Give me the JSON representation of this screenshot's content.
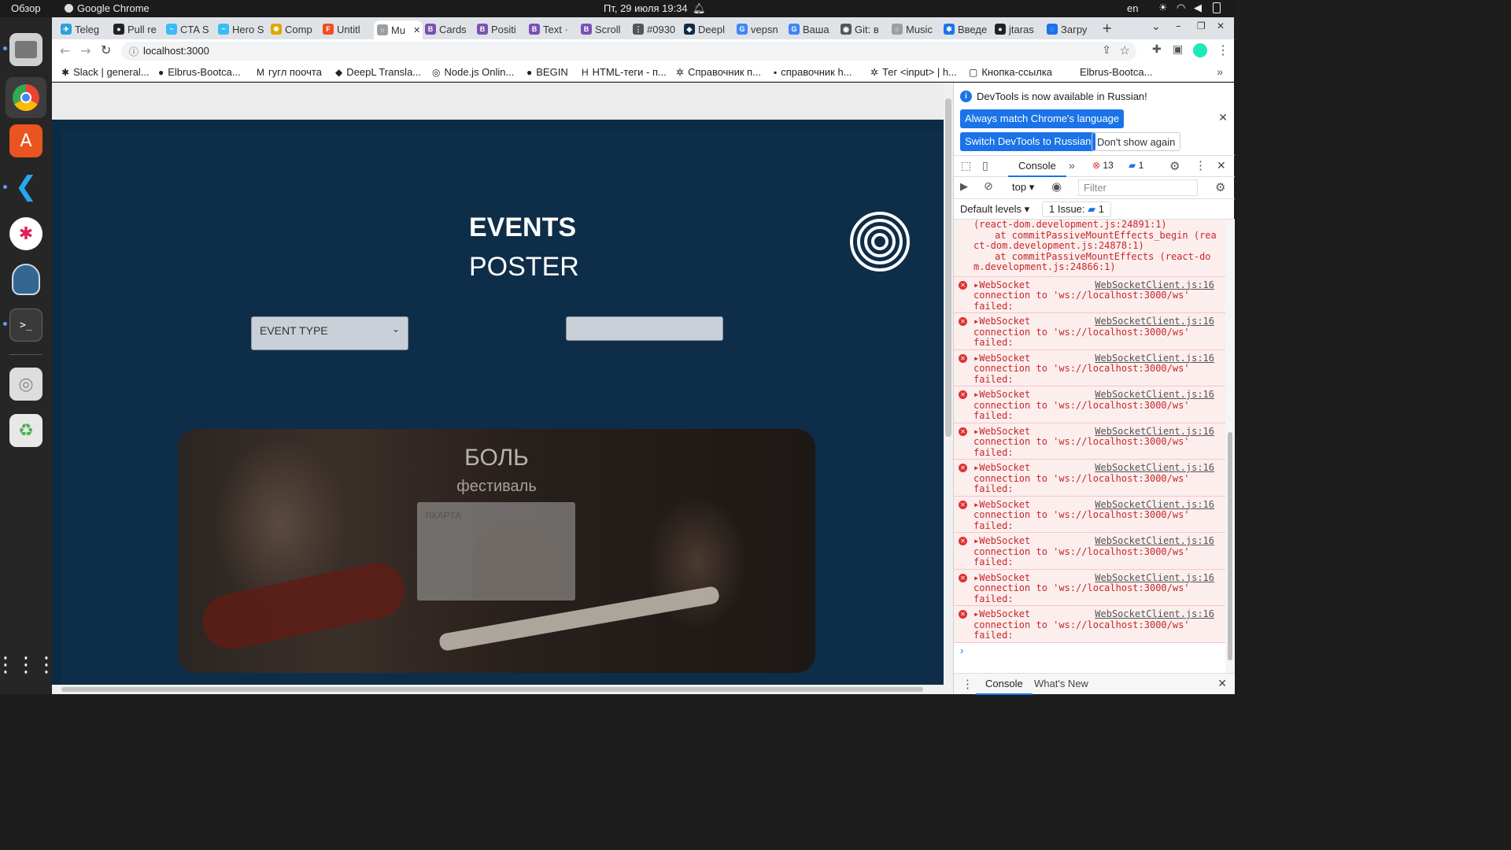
{
  "system": {
    "overview": "Обзор",
    "app_name": "Google Chrome",
    "datetime": "Пт, 29 июля  19:34",
    "lang": "en"
  },
  "tabs": [
    {
      "label": "Teleg",
      "color": "#2aa1da",
      "glyph": "✈"
    },
    {
      "label": "Pull re",
      "color": "#222222",
      "glyph": "●"
    },
    {
      "label": "CTA S",
      "color": "#38bdf8",
      "glyph": "~"
    },
    {
      "label": "Hero S",
      "color": "#38bdf8",
      "glyph": "~"
    },
    {
      "label": "Comp",
      "color": "#e0a800",
      "glyph": "✹"
    },
    {
      "label": "Untitl",
      "color": "#f24e1e",
      "glyph": "F"
    },
    {
      "label": "Mu",
      "color": "#9e9e9e",
      "glyph": "○"
    },
    {
      "label": "Cards",
      "color": "#7952b3",
      "glyph": "B"
    },
    {
      "label": "Positi",
      "color": "#7952b3",
      "glyph": "B"
    },
    {
      "label": "Text ·",
      "color": "#7952b3",
      "glyph": "B"
    },
    {
      "label": "Scroll",
      "color": "#7952b3",
      "glyph": "B"
    },
    {
      "label": "#0930",
      "color": "#555555",
      "glyph": "⋮"
    },
    {
      "label": "Deepl",
      "color": "#0f2b46",
      "glyph": "◆"
    },
    {
      "label": "vepsn",
      "color": "#4285f4",
      "glyph": "G"
    },
    {
      "label": "Ваша",
      "color": "#4285f4",
      "glyph": "G"
    },
    {
      "label": "Git: в",
      "color": "#555555",
      "glyph": "◉"
    },
    {
      "label": "Music",
      "color": "#9e9e9e",
      "glyph": "○"
    },
    {
      "label": "Введе",
      "color": "#1a73e8",
      "glyph": "✱"
    },
    {
      "label": "jtaras",
      "color": "#222222",
      "glyph": "●"
    },
    {
      "label": "Загру",
      "color": "#1a73e8",
      "glyph": "◌"
    }
  ],
  "address": {
    "url": "localhost:3000"
  },
  "bookmarks": [
    {
      "label": "Slack | general...",
      "glyph": "✱"
    },
    {
      "label": "Elbrus-Bootca...",
      "glyph": "●"
    },
    {
      "label": "гугл поочта",
      "glyph": "M"
    },
    {
      "label": "DeepL Transla...",
      "glyph": "◆"
    },
    {
      "label": "Node.js Onlin...",
      "glyph": "◎"
    },
    {
      "label": "BEGIN",
      "glyph": "●"
    },
    {
      "label": "HTML-теги - п...",
      "glyph": "H"
    },
    {
      "label": "Справочник п...",
      "glyph": "✲"
    },
    {
      "label": "справочник h...",
      "glyph": "▪"
    },
    {
      "label": "Тег <input> | h...",
      "glyph": "✲"
    },
    {
      "label": "Кнопка-ссылка",
      "glyph": "▢"
    },
    {
      "label": "Elbrus-Bootca...",
      "glyph": ""
    }
  ],
  "page": {
    "events_title": "EVENTS",
    "poster_title": "POSTER",
    "event_type_select": "EVENT TYPE",
    "card_title": "БОЛЬ",
    "card_subtitle": "фестиваль",
    "card_inner_label": "ЯКАРТА"
  },
  "devtools": {
    "banner_text": "DevTools is now available in Russian!",
    "btn_match": "Always match Chrome's language",
    "btn_switch": "Switch DevTools to Russian",
    "btn_dont_show": "Don't show again",
    "tab_console": "Console",
    "error_count": "13",
    "message_count": "1",
    "context": "top",
    "filter_placeholder": "Filter",
    "default_levels": "Default levels",
    "issues": "1 Issue:",
    "issues_count": "1",
    "stack_lines": [
      "(react-dom.development.js:24891:1)",
      "at commitPassiveMountEffects_begin (rea",
      "ct-dom.development.js:24878:1)",
      "at commitPassiveMountEffects (react-do",
      "m.development.js:24866:1)"
    ],
    "errors": [
      {
        "title": "▸WebSocket",
        "src": "WebSocketClient.js:16",
        "line2": "connection to 'ws://localhost:3000/ws'",
        "line3": "failed:"
      },
      {
        "title": "▸WebSocket",
        "src": "WebSocketClient.js:16",
        "line2": "connection to 'ws://localhost:3000/ws'",
        "line3": "failed:"
      },
      {
        "title": "▸WebSocket",
        "src": "WebSocketClient.js:16",
        "line2": "connection to 'ws://localhost:3000/ws'",
        "line3": "failed:"
      },
      {
        "title": "▸WebSocket",
        "src": "WebSocketClient.js:16",
        "line2": "connection to 'ws://localhost:3000/ws'",
        "line3": "failed:"
      },
      {
        "title": "▸WebSocket",
        "src": "WebSocketClient.js:16",
        "line2": "connection to 'ws://localhost:3000/ws'",
        "line3": "failed:"
      },
      {
        "title": "▸WebSocket",
        "src": "WebSocketClient.js:16",
        "line2": "connection to 'ws://localhost:3000/ws'",
        "line3": "failed:"
      },
      {
        "title": "▸WebSocket",
        "src": "WebSocketClient.js:16",
        "line2": "connection to 'ws://localhost:3000/ws'",
        "line3": "failed:"
      },
      {
        "title": "▸WebSocket",
        "src": "WebSocketClient.js:16",
        "line2": "connection to 'ws://localhost:3000/ws'",
        "line3": "failed:"
      },
      {
        "title": "▸WebSocket",
        "src": "WebSocketClient.js:16",
        "line2": "connection to 'ws://localhost:3000/ws'",
        "line3": "failed:"
      },
      {
        "title": "▸WebSocket",
        "src": "WebSocketClient.js:16",
        "line2": "connection to 'ws://localhost:3000/ws'",
        "line3": "failed:"
      }
    ],
    "drawer_console": "Console",
    "drawer_whats_new": "What's New"
  },
  "colors": {
    "page_bg": "#0e2d48",
    "devtools_blue": "#1a73e8",
    "error_red": "#c62828"
  }
}
